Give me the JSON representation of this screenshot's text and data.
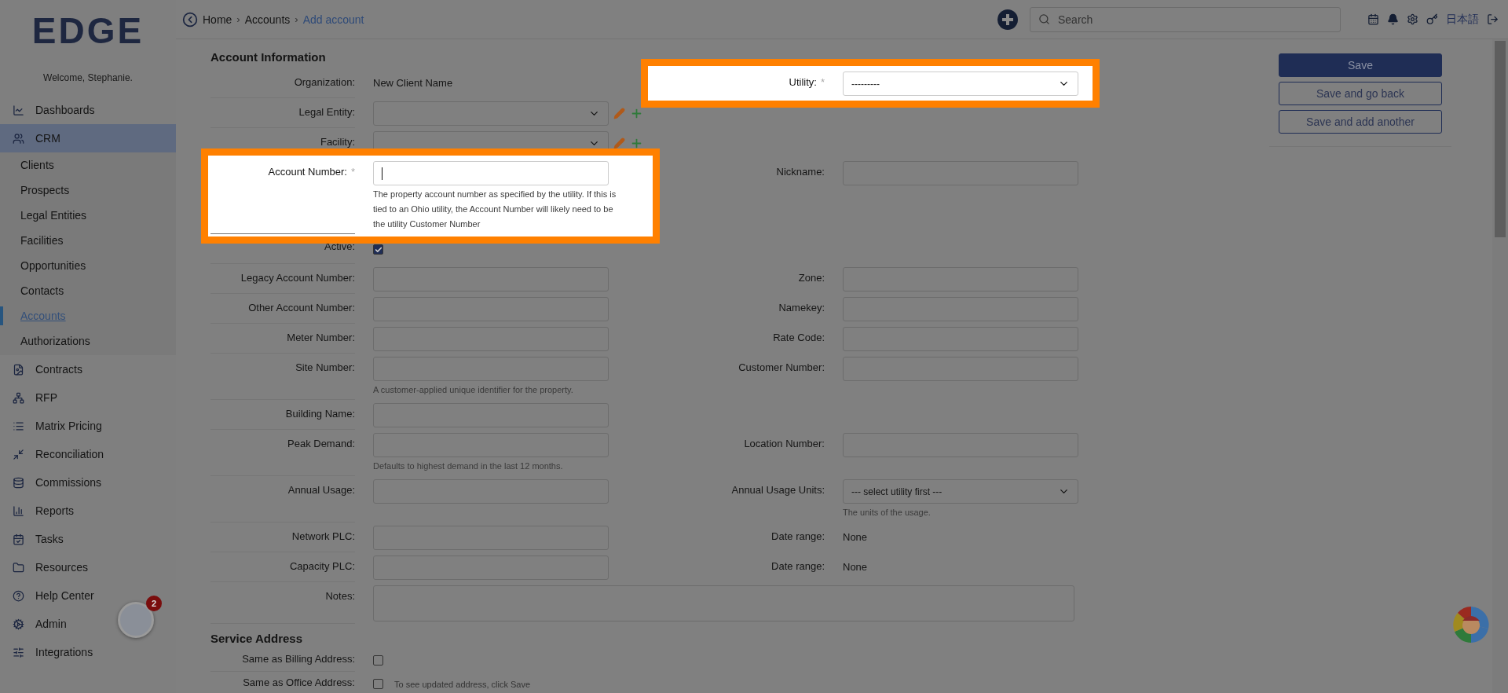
{
  "sidebar": {
    "logo": "EDGE",
    "welcome": "Welcome, Stephanie.",
    "items": [
      {
        "label": "Dashboards",
        "expanded": false
      },
      {
        "label": "CRM",
        "expanded": true,
        "children": [
          {
            "label": "Clients",
            "selected": false
          },
          {
            "label": "Prospects",
            "selected": false
          },
          {
            "label": "Legal Entities",
            "selected": false
          },
          {
            "label": "Facilities",
            "selected": false
          },
          {
            "label": "Opportunities",
            "selected": false
          },
          {
            "label": "Contacts",
            "selected": false
          },
          {
            "label": "Accounts",
            "selected": true
          },
          {
            "label": "Authorizations",
            "selected": false
          }
        ]
      },
      {
        "label": "Contracts",
        "expanded": false
      },
      {
        "label": "RFP",
        "expanded": false
      },
      {
        "label": "Matrix Pricing",
        "expanded": false
      },
      {
        "label": "Reconciliation",
        "expanded": false
      },
      {
        "label": "Commissions",
        "expanded": false
      },
      {
        "label": "Reports",
        "expanded": false
      },
      {
        "label": "Tasks",
        "expanded": false
      },
      {
        "label": "Resources",
        "expanded": false
      },
      {
        "label": "Help Center",
        "expanded": false
      },
      {
        "label": "Admin",
        "expanded": false
      },
      {
        "label": "Integrations",
        "expanded": false
      }
    ],
    "welcome_widget": {
      "badge": "2"
    }
  },
  "breadcrumbs": {
    "separator": "›",
    "items": [
      {
        "label": "Home",
        "current": false
      },
      {
        "label": "Accounts",
        "current": false
      },
      {
        "label": "Add account",
        "current": true
      }
    ]
  },
  "search": {
    "placeholder": "Search"
  },
  "language": "日本語",
  "form": {
    "title": "Account Information",
    "rows": [
      {
        "left": {
          "label": "Organization:",
          "kind": "static",
          "value": "New Client Name"
        },
        "right": {
          "label": "Utility:",
          "kind": "select",
          "value": "---------",
          "required_mark": "*",
          "highlighted": true
        }
      },
      {
        "left": {
          "label": "Legal Entity:",
          "kind": "select",
          "has_actions": true
        }
      },
      {
        "left": {
          "label": "Facility:",
          "kind": "select",
          "has_actions": true
        }
      },
      {
        "left": {
          "label": "Account Number:",
          "kind": "input",
          "required_mark": "*",
          "highlighted": true,
          "focused": true,
          "help": "The property account number as specified by the utility. If this is tied to an Ohio utility, the Account Number will likely need to be the utility Customer Number"
        },
        "right": {
          "label": "Nickname:",
          "kind": "input"
        }
      },
      {
        "left": {
          "label": "Active:",
          "kind": "checkbox",
          "checked": true
        }
      },
      {
        "left": {
          "label": "Legacy Account Number:",
          "kind": "input"
        },
        "right": {
          "label": "Zone:",
          "kind": "input"
        }
      },
      {
        "left": {
          "label": "Other Account Number:",
          "kind": "input"
        },
        "right": {
          "label": "Namekey:",
          "kind": "input"
        }
      },
      {
        "left": {
          "label": "Meter Number:",
          "kind": "input"
        },
        "right": {
          "label": "Rate Code:",
          "kind": "input"
        }
      },
      {
        "left": {
          "label": "Site Number:",
          "kind": "input",
          "help": "A customer-applied unique identifier for the property."
        },
        "right": {
          "label": "Customer Number:",
          "kind": "input"
        }
      },
      {
        "left": {
          "label": "Building Name:",
          "kind": "input"
        }
      },
      {
        "left": {
          "label": "Peak Demand:",
          "kind": "input",
          "help": "Defaults to highest demand in the last 12 months."
        },
        "right": {
          "label": "Location Number:",
          "kind": "input"
        }
      },
      {
        "left": {
          "label": "Annual Usage:",
          "kind": "input"
        },
        "right": {
          "label": "Annual Usage Units:",
          "kind": "select",
          "value": "--- select utility first ---",
          "help": "The units of the usage."
        }
      },
      {
        "left": {
          "label": "Network PLC:",
          "kind": "input"
        },
        "right": {
          "label": "Date range:",
          "kind": "static",
          "value": "None"
        }
      },
      {
        "left": {
          "label": "Capacity PLC:",
          "kind": "input"
        },
        "right": {
          "label": "Date range:",
          "kind": "static",
          "value": "None"
        }
      },
      {
        "left": {
          "label": "Notes:",
          "kind": "textarea"
        }
      }
    ]
  },
  "service_address": {
    "title": "Service Address",
    "rows": [
      {
        "label": "Same as Billing Address:",
        "checked": false
      },
      {
        "label": "Same as Office Address:",
        "checked": false,
        "note": "To see updated address, click Save"
      }
    ]
  },
  "actions": [
    {
      "label": "Save",
      "primary": true
    },
    {
      "label": "Save and go back",
      "primary": false
    },
    {
      "label": "Save and add another",
      "primary": false
    }
  ]
}
